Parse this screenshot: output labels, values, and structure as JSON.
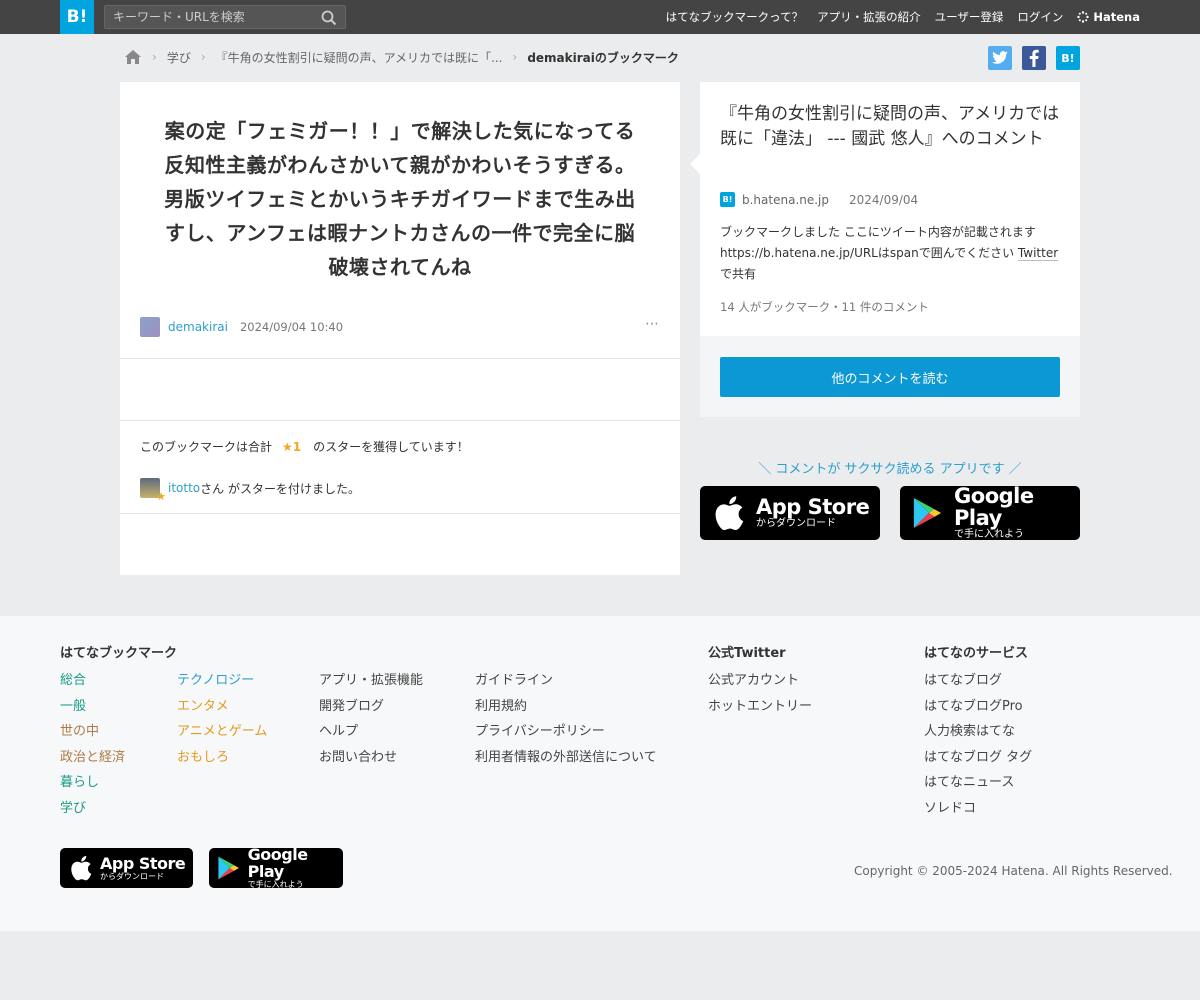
{
  "header": {
    "logo": "B!",
    "search_placeholder": "キーワード・URLを検索",
    "nav": [
      "はてなブックマークって？",
      "アプリ・拡張の紹介",
      "ユーザー登録",
      "ログイン"
    ],
    "brand": "Hatena"
  },
  "breadcrumb": {
    "category": "学び",
    "article": "『牛角の女性割引に疑問の声、アメリカでは既に「...",
    "current": "demakiraiのブックマーク"
  },
  "share": {
    "hatena": "B!"
  },
  "bookmark": {
    "comment": "案の定「フェミガー！！」で解決した気になってる反知性主義がわんさかいて親がかわいそうすぎる。男版ツイフェミとかいうキチガイワードまで生み出すし、アンフェは暇ナントカさんの一件で完全に脳破壊されてんね",
    "user": "demakirai",
    "datetime": "2024/09/04 10:40",
    "more": "⋯"
  },
  "stars": {
    "prefix": "このブックマークは合計",
    "count": "★1",
    "suffix": "のスターを獲得しています！",
    "starrer_name": "itotto",
    "starrer_suffix": "さん がスターを付けました。"
  },
  "entry": {
    "title": "『牛角の女性割引に疑問の声、アメリカでは既に「違法」 --- 國武 悠人』へのコメント",
    "source": "b.hatena.ne.jp",
    "date": "2024/09/04",
    "desc_pre": "ブックマークしました ここにツイート内容が記載されます https://b.hatena.ne.jp/URLはspanで囲んでください ",
    "desc_link": "Twitter",
    "desc_post": "で共有",
    "counts": "14 人がブックマーク・11 件のコメント",
    "read_more": "他のコメントを読む"
  },
  "apps": {
    "promo": "＼ コメントが サクサク読める アプリです ／",
    "appstore_title": "App Store",
    "appstore_sub": "からダウンロード",
    "gplay_title": "Google Play",
    "gplay_sub": "で手に入れよう"
  },
  "footer": {
    "col_bookmark_title": "はてなブックマーク",
    "cats1": [
      "総合",
      "一般",
      "世の中",
      "政治と経済",
      "暮らし",
      "学び"
    ],
    "cats2": [
      "テクノロジー",
      "エンタメ",
      "アニメとゲーム",
      "おもしろ"
    ],
    "links1": [
      "アプリ・拡張機能",
      "開発ブログ",
      "ヘルプ",
      "お問い合わせ"
    ],
    "links2": [
      "ガイドライン",
      "利用規約",
      "プライバシーポリシー",
      "利用者情報の外部送信について"
    ],
    "twitter_title": "公式Twitter",
    "twitter_links": [
      "公式アカウント",
      "ホットエントリー"
    ],
    "services_title": "はてなのサービス",
    "services": [
      "はてなブログ",
      "はてなブログPro",
      "人力検索はてな",
      "はてなブログ タグ",
      "はてなニュース",
      "ソレドコ"
    ],
    "copyright": "Copyright © 2005-2024 Hatena. All Rights Reserved."
  }
}
